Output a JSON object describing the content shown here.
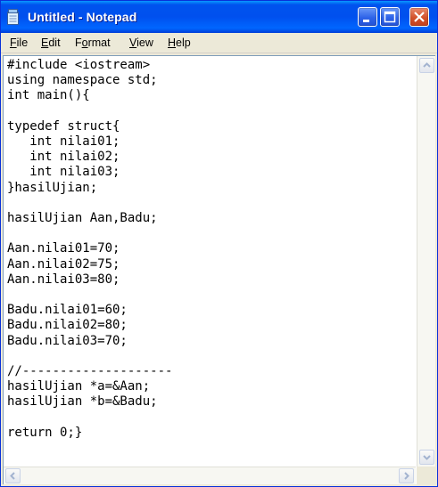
{
  "window": {
    "title": "Untitled - Notepad",
    "colors": {
      "titlebar": "#0a246a",
      "accent": "#0054e3",
      "close": "#d3522a"
    }
  },
  "icons": {
    "app": "notepad-icon",
    "minimize": "minimize-icon",
    "maximize": "maximize-icon",
    "close": "close-icon",
    "scroll_up": "chevron-up-icon",
    "scroll_down": "chevron-down-icon",
    "scroll_left": "chevron-left-icon",
    "scroll_right": "chevron-right-icon"
  },
  "menu": {
    "file": {
      "u": "F",
      "rest": "ile"
    },
    "edit": {
      "u": "E",
      "rest": "dit"
    },
    "format": {
      "pre": "F",
      "u": "o",
      "rest": "rmat"
    },
    "view": {
      "u": "V",
      "rest": "iew"
    },
    "help": {
      "u": "H",
      "rest": "elp"
    }
  },
  "editor": {
    "content": "#include <iostream>\nusing namespace std;\nint main(){\n\ntypedef struct{\n   int nilai01;\n   int nilai02;\n   int nilai03;\n}hasilUjian;\n\nhasilUjian Aan,Badu;\n\nAan.nilai01=70;\nAan.nilai02=75;\nAan.nilai03=80;\n\nBadu.nilai01=60;\nBadu.nilai02=80;\nBadu.nilai03=70;\n\n//--------------------\nhasilUjian *a=&Aan;\nhasilUjian *b=&Badu;\n\nreturn 0;}"
  }
}
